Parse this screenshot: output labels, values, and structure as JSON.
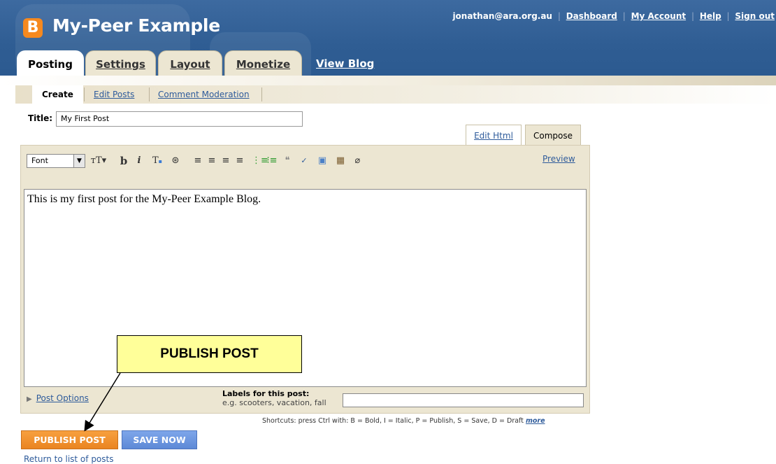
{
  "header": {
    "logo_letter": "B",
    "blog_title": "My-Peer Example",
    "user_email": "jonathan@ara.org.au",
    "nav_links": [
      "Dashboard",
      "My Account",
      "Help",
      "Sign out"
    ]
  },
  "tabs": [
    "Posting",
    "Settings",
    "Layout",
    "Monetize"
  ],
  "view_blog": "View Blog",
  "subnav": [
    "Create",
    "Edit Posts",
    "Comment Moderation"
  ],
  "post": {
    "title_label": "Title:",
    "title_value": "My First Post",
    "body": "This is my first post for the My-Peer Example Blog."
  },
  "editor_tabs": {
    "edit_html": "Edit Html",
    "compose": "Compose"
  },
  "toolbar": {
    "font_label": "Font",
    "preview": "Preview"
  },
  "options": {
    "post_options": "Post Options",
    "labels_label": "Labels for this post:",
    "labels_hint": "e.g. scooters, vacation, fall"
  },
  "shortcuts": {
    "text": "Shortcuts: press Ctrl with: B = Bold, I = Italic, P = Publish, S = Save, D = Draft",
    "more": "more"
  },
  "buttons": {
    "publish": "PUBLISH POST",
    "save": "SAVE NOW"
  },
  "return_link": "Return to list of posts",
  "callout": "PUBLISH POST",
  "colors": {
    "header_blue": "#2f5d93",
    "publish_orange": "#ea8421",
    "save_blue": "#5d89d6",
    "callout_yellow": "#ffff99",
    "link_blue": "#2e5b9b"
  }
}
